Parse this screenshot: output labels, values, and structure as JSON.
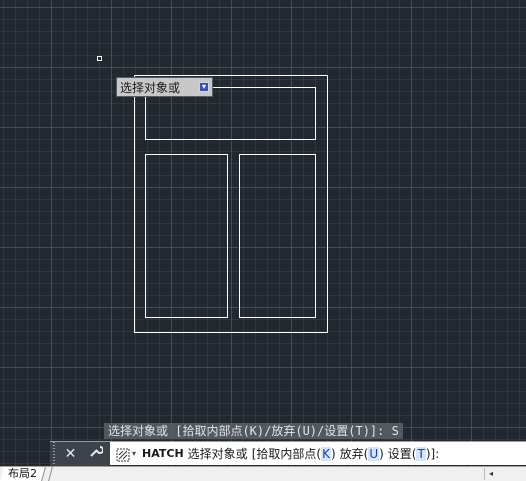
{
  "tooltip": {
    "text": "选择对象或",
    "icon": "arrow-down-icon"
  },
  "history": {
    "text": "选择对象或 [拾取内部点(K)/放弃(U)/设置(T)]: S"
  },
  "command_line": {
    "close_icon": "close-icon",
    "customize_icon": "wrench-icon",
    "recent_icon": "hatch-command-icon",
    "command_name": "HATCH",
    "prompt": "选择对象或",
    "options": [
      {
        "open": "[拾取内部点(",
        "key": "K",
        "close": ")"
      },
      {
        "open": "放弃(",
        "key": "U",
        "close": ")"
      },
      {
        "open": "设置(",
        "key": "T",
        "close": ")]:"
      }
    ]
  },
  "layout_tabs": [
    {
      "label": "布局2"
    }
  ],
  "colors": {
    "canvas_bg": "#212830",
    "geometry": "#ffffff",
    "option_key": "#1c3fa8"
  }
}
